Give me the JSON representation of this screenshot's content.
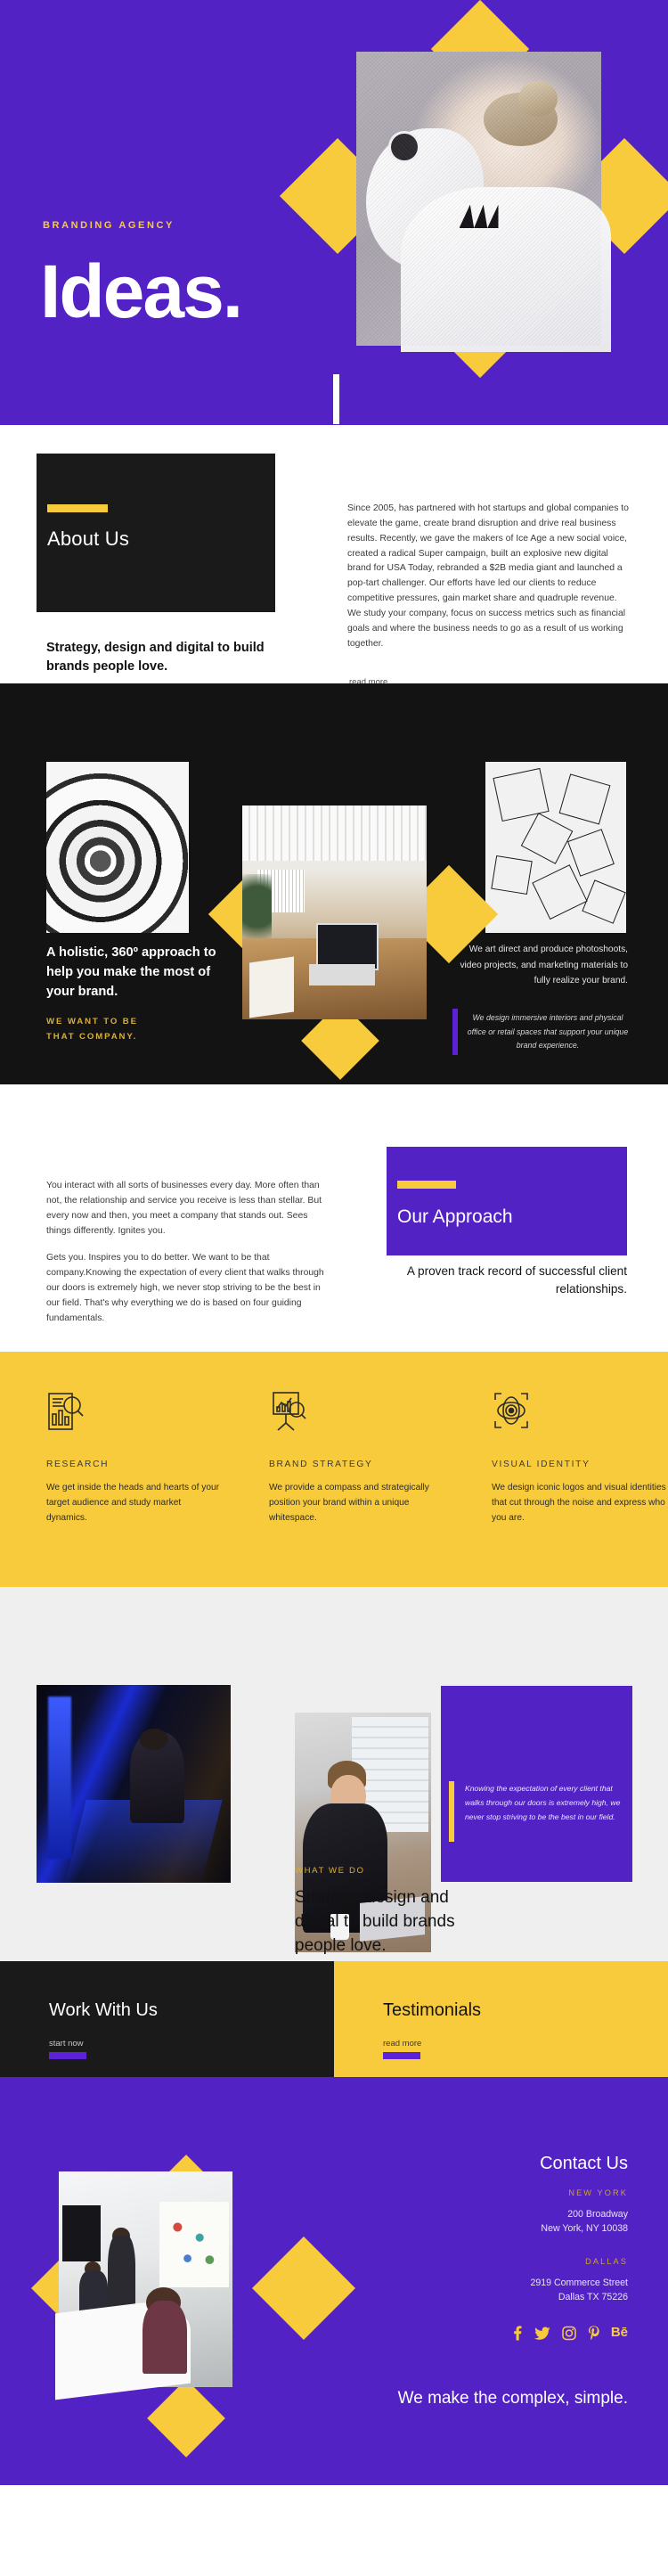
{
  "colors": {
    "purple": "#5222C4",
    "yellow": "#F8CB3C",
    "dark": "#1A1A1A",
    "link_purple": "#5B22D8"
  },
  "hero": {
    "eyebrow": "BRANDING AGENCY",
    "title": "Ideas."
  },
  "about": {
    "heading": "About Us",
    "tagline": "Strategy, design and digital to build brands people love.",
    "body": "Since 2005,  has partnered with hot startups and global companies to elevate the game, create brand disruption and drive real business results. Recently, we gave the makers of Ice Age a new social voice, created a radical Super campaign, built an explosive new digital brand for USA Today, rebranded a $2B media giant and launched a pop-tart challenger. Our efforts have led our clients to reduce competitive pressures, gain market share and quadruple revenue. We study your company, focus on success metrics such as financial goals and where the business needs to go as a result of us working together.",
    "read_more": "read more"
  },
  "dark_section": {
    "headline": "A holistic, 360º approach to help you make the most of your brand.",
    "kicker": "WE WANT TO BE\nTHAT COMPANY.",
    "right_body": "We art direct and produce photoshoots, video projects, and marketing materials to fully realize your brand.",
    "right_quote": "We design immersive interiors and physical office or retail spaces that support your unique brand experience."
  },
  "approach": {
    "paragraph_1": "You interact with all sorts of businesses every day. More often than not, the relationship and service you receive is less than stellar. But every now and then, you meet a company that stands out. Sees things differently. Ignites you.",
    "paragraph_2": "Gets you. Inspires you to do better. We want to be that company.Knowing the expectation of every client that walks through our doors is extremely high, we never stop striving to be the best in our field. That's why everything we do is based on four guiding fundamentals.",
    "heading": "Our Approach",
    "subheading": "A proven track record of successful client relationships."
  },
  "services": [
    {
      "icon": "research-chart-magnifier-icon",
      "title": "RESEARCH",
      "text": "We get inside the heads and hearts of your target audience and study market dynamics."
    },
    {
      "icon": "brand-strategy-easel-icon",
      "title": "BRAND STRATEGY",
      "text": "We provide a compass and strategically position your brand within a unique whitespace."
    },
    {
      "icon": "visual-identity-eye-target-icon",
      "title": "VISUAL IDENTITY",
      "text": "We design iconic logos and visual identities that cut through the noise and express who you are."
    }
  ],
  "what_we_do": {
    "kicker": "WHAT WE DO",
    "heading": "Strategy, design and digital to build brands people love.",
    "quote": "Knowing the expectation of every client that walks through our doors is extremely high, we never stop striving to be the best in our field."
  },
  "cta": {
    "work": {
      "title": "Work With Us",
      "link": "start now"
    },
    "testimonials": {
      "title": "Testimonials",
      "link": "read more"
    }
  },
  "footer": {
    "heading": "Contact Us",
    "offices": [
      {
        "city": "NEW YORK",
        "line1": "200 Broadway",
        "line2": "New York, NY 10038"
      },
      {
        "city": "DALLAS",
        "line1": "2919 Commerce Street",
        "line2": "Dallas TX 75226"
      }
    ],
    "social": [
      {
        "name": "facebook-icon",
        "glyph": "f"
      },
      {
        "name": "twitter-icon",
        "glyph": "ᵛ"
      },
      {
        "name": "instagram-icon",
        "glyph": "▢"
      },
      {
        "name": "pinterest-icon",
        "glyph": "P"
      },
      {
        "name": "behance-icon",
        "glyph": "Bē"
      }
    ],
    "slogan": "We make the complex, simple."
  }
}
